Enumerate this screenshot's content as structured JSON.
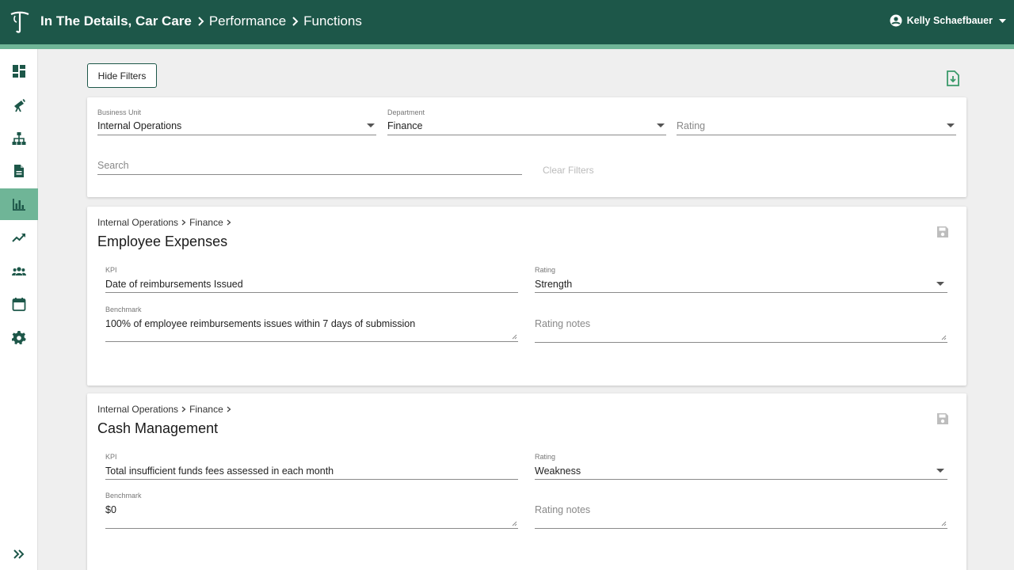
{
  "header": {
    "org": "In The Details, Car Care",
    "breadcrumbs": [
      "Performance",
      "Functions"
    ],
    "user": "Kelly Schaefbauer"
  },
  "colors": {
    "primary": "#1d5749",
    "accent": "#6fb597"
  },
  "sidebar": {
    "items": [
      {
        "icon": "dashboard-icon"
      },
      {
        "icon": "telescope-icon"
      },
      {
        "icon": "org-chart-icon"
      },
      {
        "icon": "document-icon"
      },
      {
        "icon": "bar-chart-icon",
        "active": true
      },
      {
        "icon": "trend-icon"
      },
      {
        "icon": "people-icon"
      },
      {
        "icon": "calendar-icon"
      },
      {
        "icon": "settings-icon"
      }
    ],
    "expand_icon": "double-chevron-right-icon"
  },
  "toolbar": {
    "hide_filters": "Hide Filters",
    "export_icon": "export-file-icon"
  },
  "filters": {
    "business_unit": {
      "label": "Business Unit",
      "value": "Internal Operations"
    },
    "department": {
      "label": "Department",
      "value": "Finance"
    },
    "rating": {
      "placeholder": "Rating"
    },
    "search": {
      "placeholder": "Search"
    },
    "clear": "Clear Filters"
  },
  "functions": [
    {
      "breadcrumb": [
        "Internal Operations",
        "Finance"
      ],
      "title": "Employee Expenses",
      "kpi_label": "KPI",
      "kpi": "Date of reimbursements Issued",
      "rating_label": "Rating",
      "rating": "Strength",
      "benchmark_label": "Benchmark",
      "benchmark": "100% of employee reimbursements issues within 7 days of submission",
      "rating_notes_placeholder": "Rating notes"
    },
    {
      "breadcrumb": [
        "Internal Operations",
        "Finance"
      ],
      "title": "Cash Management",
      "kpi_label": "KPI",
      "kpi": "Total insufficient funds fees assessed in each month",
      "rating_label": "Rating",
      "rating": "Weakness",
      "benchmark_label": "Benchmark",
      "benchmark": "$0",
      "rating_notes_placeholder": "Rating notes"
    }
  ]
}
